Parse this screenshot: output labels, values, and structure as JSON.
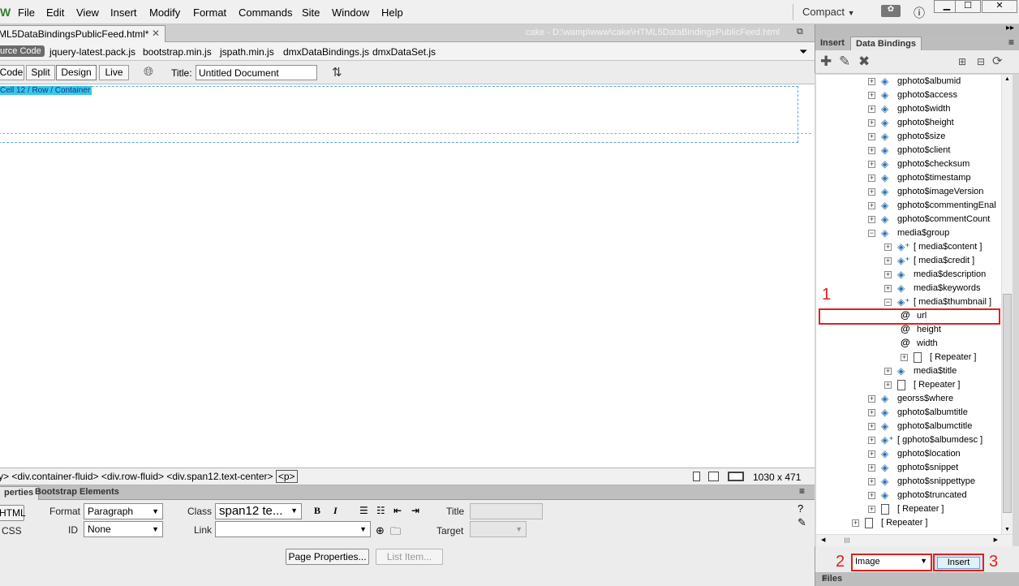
{
  "menubar": {
    "logo": "W",
    "items": [
      "File",
      "Edit",
      "View",
      "Insert",
      "Modify",
      "Format",
      "Commands",
      "Site",
      "Window",
      "Help"
    ],
    "workspace": "Compact",
    "window_controls": [
      "minimize",
      "maximize",
      "close"
    ]
  },
  "document": {
    "tab_title": "ML5DataBindingsPublicFeed.html*",
    "path": "cake - D:\\wamp\\www\\cake\\HTML5DataBindingsPublicFeed.html"
  },
  "related_files": {
    "source_label": "urce Code",
    "files": [
      "jquery-latest.pack.js",
      "bootstrap.min.js",
      "jspath.min.js",
      "dmxDataBindings.js",
      "dmxDataSet.js"
    ]
  },
  "doc_toolbar": {
    "views": [
      "Code",
      "Split",
      "Design",
      "Live"
    ],
    "active_view": "Design",
    "title_label": "Title:",
    "title_value": "Untitled Document"
  },
  "design_view": {
    "badge": "Cell 12 / Row / Container"
  },
  "tag_selector": {
    "path": "y> <div.container-fluid> <div.row-fluid> <div.span12.text-center>",
    "current": "<p>",
    "dimensions": "1030 x 471"
  },
  "properties": {
    "tabs": [
      "perties",
      "Bootstrap Elements"
    ],
    "html_btn": "HTML",
    "css_btn": "CSS",
    "format_label": "Format",
    "format_value": "Paragraph",
    "class_label": "Class",
    "class_value": "span12 te...",
    "id_label": "ID",
    "id_value": "None",
    "link_label": "Link",
    "title_label": "Title",
    "target_label": "Target",
    "page_properties_btn": "Page Properties...",
    "list_item_btn": "List Item..."
  },
  "right_panel": {
    "tabs": [
      "Insert",
      "Data Bindings"
    ],
    "active_tab": "Data Bindings",
    "tree": [
      {
        "label": "gphoto$albumid",
        "indent": 0,
        "type": "item"
      },
      {
        "label": "gphoto$access",
        "indent": 0,
        "type": "item"
      },
      {
        "label": "gphoto$width",
        "indent": 0,
        "type": "item"
      },
      {
        "label": "gphoto$height",
        "indent": 0,
        "type": "item"
      },
      {
        "label": "gphoto$size",
        "indent": 0,
        "type": "item"
      },
      {
        "label": "gphoto$client",
        "indent": 0,
        "type": "item"
      },
      {
        "label": "gphoto$checksum",
        "indent": 0,
        "type": "item"
      },
      {
        "label": "gphoto$timestamp",
        "indent": 0,
        "type": "item"
      },
      {
        "label": "gphoto$imageVersion",
        "indent": 0,
        "type": "item"
      },
      {
        "label": "gphoto$commentingEnal",
        "indent": 0,
        "type": "item"
      },
      {
        "label": "gphoto$commentCount",
        "indent": 0,
        "type": "item"
      },
      {
        "label": "media$group",
        "indent": 0,
        "type": "item",
        "expanded": true
      },
      {
        "label": "[ media$content ]",
        "indent": 1,
        "type": "array"
      },
      {
        "label": "[ media$credit ]",
        "indent": 1,
        "type": "array"
      },
      {
        "label": "media$description",
        "indent": 1,
        "type": "item"
      },
      {
        "label": "media$keywords",
        "indent": 1,
        "type": "item"
      },
      {
        "label": "[ media$thumbnail ]",
        "indent": 1,
        "type": "array",
        "expanded": true
      },
      {
        "label": "url",
        "indent": 2,
        "type": "field"
      },
      {
        "label": "height",
        "indent": 2,
        "type": "field"
      },
      {
        "label": "width",
        "indent": 2,
        "type": "field"
      },
      {
        "label": "[ Repeater ]",
        "indent": 2,
        "type": "repeater"
      },
      {
        "label": "media$title",
        "indent": 1,
        "type": "item"
      },
      {
        "label": "[ Repeater ]",
        "indent": 1,
        "type": "repeater"
      },
      {
        "label": "georss$where",
        "indent": 0,
        "type": "item"
      },
      {
        "label": "gphoto$albumtitle",
        "indent": 0,
        "type": "item"
      },
      {
        "label": "gphoto$albumctitle",
        "indent": 0,
        "type": "item"
      },
      {
        "label": "[ gphoto$albumdesc ]",
        "indent": 0,
        "type": "array"
      },
      {
        "label": "gphoto$location",
        "indent": 0,
        "type": "item"
      },
      {
        "label": "gphoto$snippet",
        "indent": 0,
        "type": "item"
      },
      {
        "label": "gphoto$snippettype",
        "indent": 0,
        "type": "item"
      },
      {
        "label": "gphoto$truncated",
        "indent": 0,
        "type": "item"
      },
      {
        "label": "[ Repeater ]",
        "indent": 0,
        "type": "repeater"
      },
      {
        "label": "[ Repeater ]",
        "indent": -1,
        "type": "repeater"
      }
    ],
    "selected_item": "url",
    "format_select": "Image",
    "insert_btn": "Insert",
    "files_tab": "Files",
    "annotations": [
      "1",
      "2",
      "3"
    ]
  },
  "colors": {
    "annotation_red": "#e02020",
    "badge_blue": "#39c6f0",
    "icon_blue": "#2c6fb0"
  }
}
